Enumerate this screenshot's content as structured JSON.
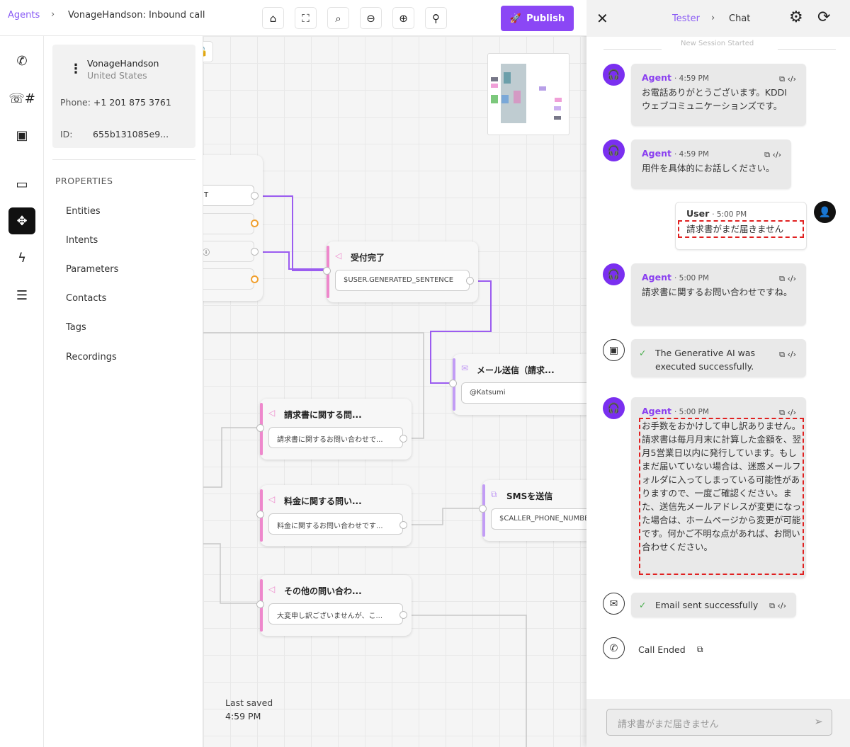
{
  "header": {
    "breadcrumb_root": "Agents",
    "breadcrumb_sep": "›",
    "breadcrumb_current": "VonageHandson: Inbound call",
    "publish_label": "Publish",
    "accent": "#8b47f5"
  },
  "agent_card": {
    "name": "VonageHandson",
    "country": "United States",
    "phone_label": "Phone:",
    "phone": "+1 201 875 3761",
    "id_label": "ID:",
    "id": "655b131085e9..."
  },
  "properties": {
    "heading": "PROPERTIES",
    "items": [
      "Entities",
      "Intents",
      "Parameters",
      "Contacts",
      "Tags",
      "Recordings"
    ]
  },
  "canvas": {
    "partial_node_rows": [
      "T",
      "",
      "",
      ""
    ],
    "nodes": [
      {
        "title": "受付完了",
        "field": "$USER.GENERATED_SENTENCE"
      },
      {
        "title": "メール送信（請求...",
        "field": "@Katsumi"
      },
      {
        "title": "請求書に関する問...",
        "field": "請求書に関するお問い合わせで..."
      },
      {
        "title": "料金に関する問い...",
        "field": "料金に関するお問い合わせです..."
      },
      {
        "title": "SMSを送信",
        "field": "$CALLER_PHONE_NUMBER"
      },
      {
        "title": "その他の問い合わ...",
        "field": "大変申し訳ございませんが、こ..."
      }
    ],
    "last_saved_label": "Last saved",
    "last_saved_time": "4:59 PM"
  },
  "chat": {
    "crumb_root": "Tester",
    "crumb_sep": "›",
    "crumb_current": "Chat",
    "session_note": "New Session Started",
    "messages": [
      {
        "who": "Agent",
        "time": "· 4:59 PM",
        "text": "お電話ありがとうございます。KDDIウェブコミュニケーションズです。"
      },
      {
        "who": "Agent",
        "time": "· 4:59 PM",
        "text": "用件を具体的にお話しください。"
      },
      {
        "who": "User",
        "time": "· 5:00 PM",
        "text": "請求書がまだ届きません"
      },
      {
        "who": "Agent",
        "time": "· 5:00 PM",
        "text": "請求書に関するお問い合わせですね。"
      },
      {
        "text": "The Generative AI was executed successfully."
      },
      {
        "who": "Agent",
        "time": "· 5:00 PM",
        "text": "お手数をおかけして申し訳ありません。請求書は毎月月末に計算した金額を、翌月5営業日以内に発行しています。もしまだ届いていない場合は、迷惑メールフォルダに入ってしまっている可能性がありますので、一度ご確認ください。また、送信先メールアドレスが変更になった場合は、ホームページから変更が可能です。何かご不明な点があれば、お問い合わせください。"
      },
      {
        "text": "Email sent successfully"
      },
      {
        "text": "Call Ended"
      }
    ],
    "input_placeholder": "請求書がまだ届きません"
  }
}
